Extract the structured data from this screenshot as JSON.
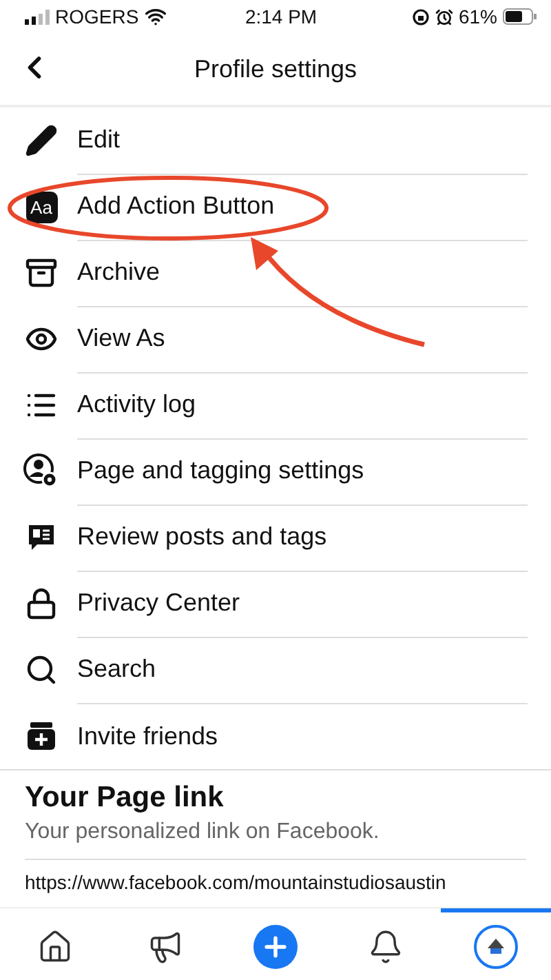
{
  "status_bar": {
    "carrier": "ROGERS",
    "time": "2:14 PM",
    "battery": "61%"
  },
  "header": {
    "title": "Profile settings"
  },
  "menu": [
    {
      "label": "Edit",
      "circled": false
    },
    {
      "label": "Add Action Button",
      "badge": "Aa",
      "circled": true
    },
    {
      "label": "Archive",
      "circled": false
    },
    {
      "label": "View As",
      "circled": false
    },
    {
      "label": "Activity log",
      "circled": false
    },
    {
      "label": "Page and tagging settings",
      "circled": false
    },
    {
      "label": "Review posts and tags",
      "circled": false
    },
    {
      "label": "Privacy Center",
      "circled": false
    },
    {
      "label": "Search",
      "circled": false
    },
    {
      "label": "Invite friends",
      "circled": false
    }
  ],
  "page_link": {
    "title": "Your Page link",
    "subtitle": "Your personalized link on Facebook.",
    "url": "https://www.facebook.com/mountainstudiosaustin"
  },
  "tab_bar": [
    {
      "selected": false
    },
    {
      "selected": false
    },
    {
      "selected": false
    },
    {
      "selected": false
    },
    {
      "selected": true
    }
  ]
}
